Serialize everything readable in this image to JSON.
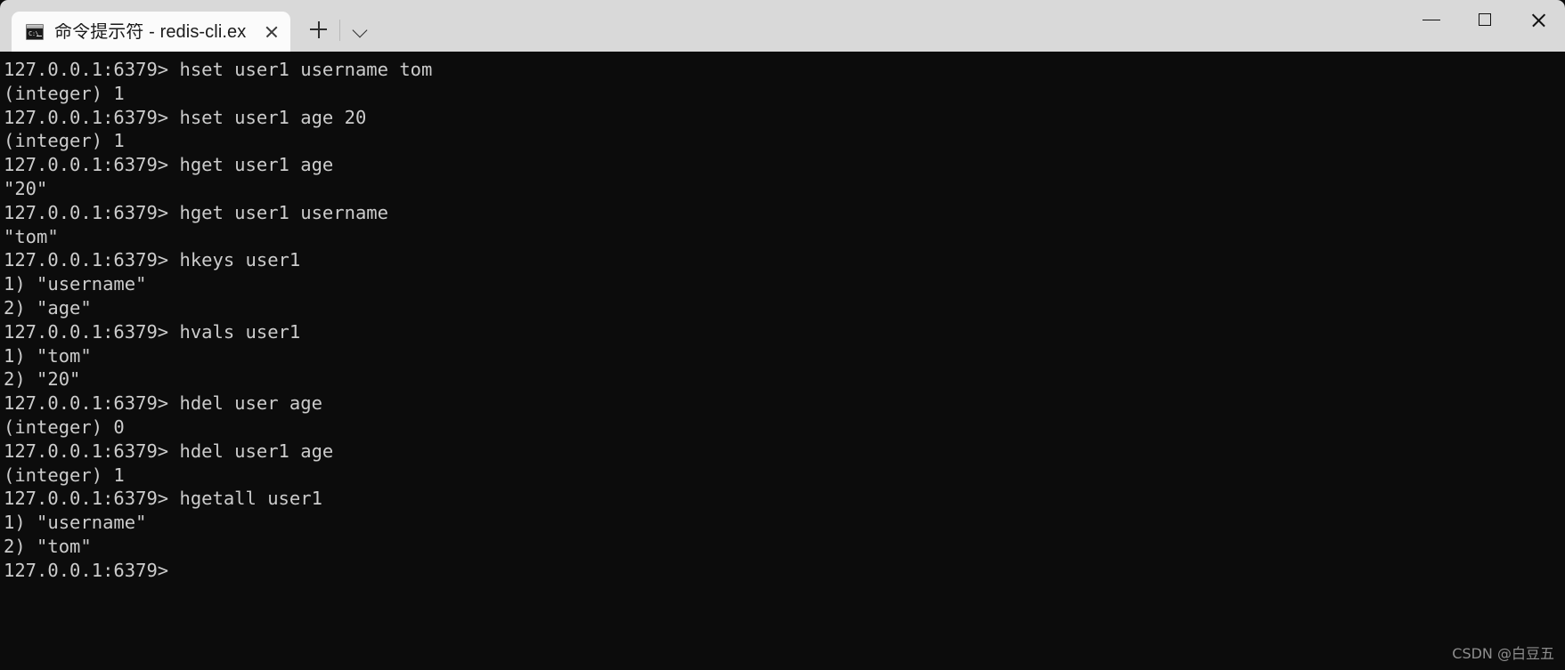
{
  "window": {
    "tab": {
      "icon": "command-prompt-icon",
      "title": "命令提示符 - redis-cli.ex",
      "close_label": "×"
    },
    "new_tab_label": "+",
    "dropdown_label": "⌄",
    "controls": {
      "minimize_label": "—",
      "maximize_label": "□",
      "close_label": "✕"
    },
    "colors": {
      "titlebar_bg": "#d9d9d9",
      "tab_bg": "#fbfbfb",
      "terminal_bg": "#0c0c0c",
      "terminal_fg": "#cccccc"
    }
  },
  "terminal": {
    "prompt": "127.0.0.1:6379>",
    "lines": [
      "127.0.0.1:6379> hset user1 username tom",
      "(integer) 1",
      "127.0.0.1:6379> hset user1 age 20",
      "(integer) 1",
      "127.0.0.1:6379> hget user1 age",
      "\"20\"",
      "127.0.0.1:6379> hget user1 username",
      "\"tom\"",
      "127.0.0.1:6379> hkeys user1",
      "1) \"username\"",
      "2) \"age\"",
      "127.0.0.1:6379> hvals user1",
      "1) \"tom\"",
      "2) \"20\"",
      "127.0.0.1:6379> hdel user age",
      "(integer) 0",
      "127.0.0.1:6379> hdel user1 age",
      "(integer) 1",
      "127.0.0.1:6379> hgetall user1",
      "1) \"username\"",
      "2) \"tom\"",
      "127.0.0.1:6379>"
    ]
  },
  "watermark": {
    "text": "CSDN @白豆五"
  }
}
